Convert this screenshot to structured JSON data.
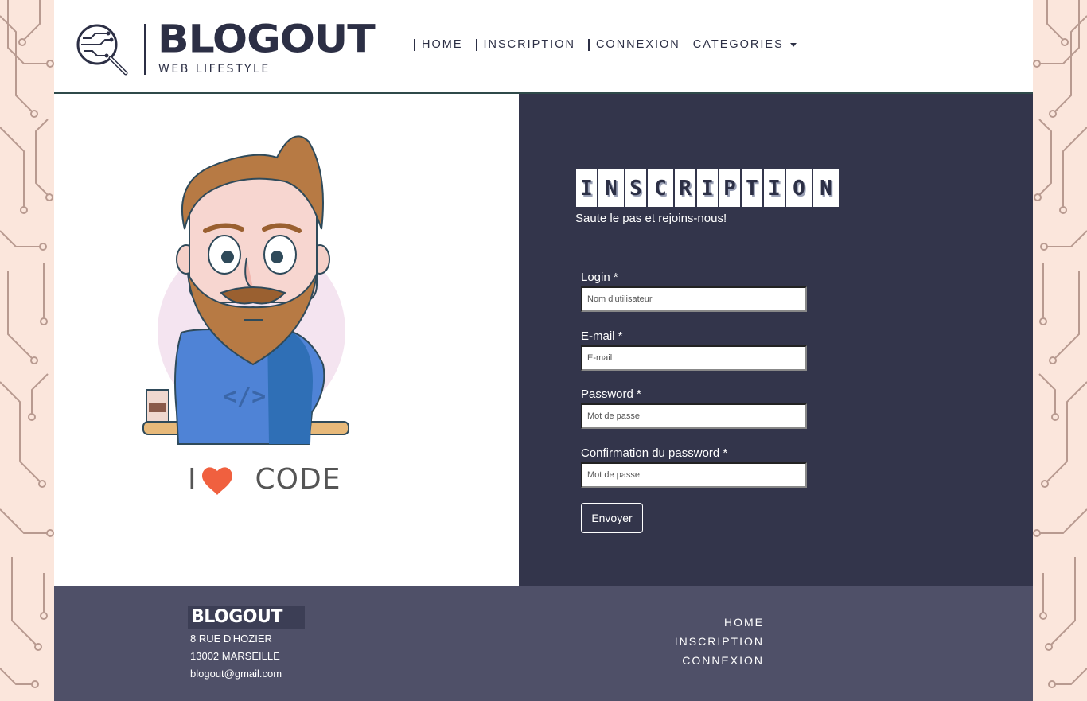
{
  "header": {
    "logo_text": "BLOGOUT",
    "logo_sub": "WEB LIFESTYLE",
    "nav": [
      {
        "label": "HOME"
      },
      {
        "label": "INSCRIPTION"
      },
      {
        "label": "CONNEXION"
      },
      {
        "label": "CATEGORIES"
      }
    ]
  },
  "illustration": {
    "caption_left": "I",
    "caption_right": "CODE"
  },
  "form": {
    "title_letters": [
      "I",
      "N",
      "S",
      "C",
      "R",
      "I",
      "P",
      "T",
      "I",
      "O",
      "N"
    ],
    "subtitle": "Saute le pas et rejoins-nous!",
    "fields": [
      {
        "label": "Login *",
        "placeholder": "Nom d'utilisateur"
      },
      {
        "label": "E-mail *",
        "placeholder": "E-mail"
      },
      {
        "label": "Password *",
        "placeholder": "Mot de passe"
      },
      {
        "label": "Confirmation du password *",
        "placeholder": "Mot de passe"
      }
    ],
    "submit_label": "Envoyer"
  },
  "footer": {
    "logo_text": "BLOGOUT",
    "address_line1": "8 RUE D'HOZIER",
    "address_line2": "13002 MARSEILLE",
    "email": "blogout@gmail.com",
    "links": [
      {
        "label": "HOME"
      },
      {
        "label": "INSCRIPTION"
      },
      {
        "label": "CONNEXION"
      }
    ]
  },
  "colors": {
    "dark_navy": "#33354b",
    "footer_bg": "#4f5068",
    "background_peach": "#fbe6dc",
    "heart": "#f0603f"
  }
}
